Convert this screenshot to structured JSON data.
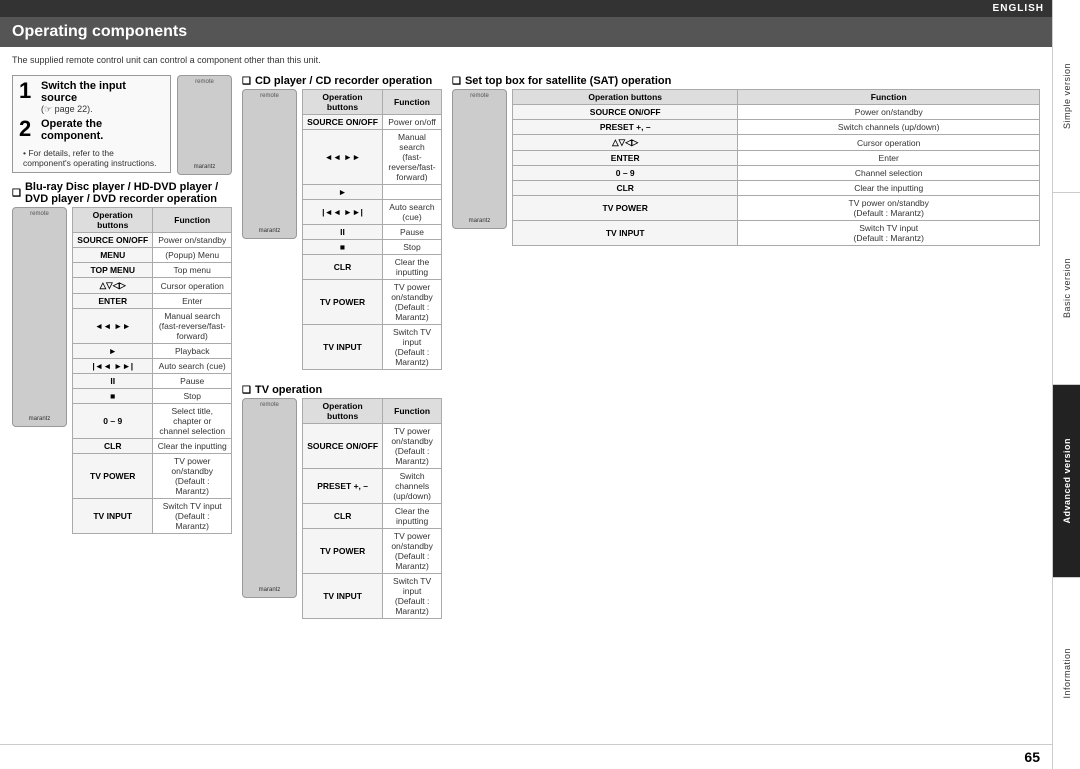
{
  "topbar": {
    "label": "ENGLISH"
  },
  "page_header": {
    "title": "Operating components"
  },
  "intro": {
    "text": "The supplied remote control unit can control a component other than this unit."
  },
  "steps": {
    "step1_num": "1",
    "step1_title": "Switch the input source",
    "step1_sub": "(☞ page 22).",
    "step2_num": "2",
    "step2_title": "Operate the component.",
    "step2_note": "• For details, refer to the component's operating instructions."
  },
  "sections": {
    "bluray": {
      "heading": "Blu-ray Disc player / HD-DVD player / DVD player / DVD recorder operation",
      "col_buttons": "Operation buttons",
      "col_function": "Function",
      "rows": [
        {
          "button": "SOURCE ON/OFF",
          "function": "Power on/standby"
        },
        {
          "button": "MENU",
          "function": "(Popup) Menu"
        },
        {
          "button": "TOP MENU",
          "function": "Top menu"
        },
        {
          "button": "△▽◁▷",
          "function": "Cursor operation"
        },
        {
          "button": "ENTER",
          "function": "Enter"
        },
        {
          "button": "◄◄ ►►",
          "function": "Manual search\n(fast-reverse/fast-forward)"
        },
        {
          "button": "►",
          "function": "Playback"
        },
        {
          "button": "|◄◄  ►►|",
          "function": "Auto search (cue)"
        },
        {
          "button": "II",
          "function": "Pause"
        },
        {
          "button": "■",
          "function": "Stop"
        },
        {
          "button": "0 – 9",
          "function": "Select title, chapter or channel selection"
        },
        {
          "button": "CLR",
          "function": "Clear the inputting"
        },
        {
          "button": "TV POWER",
          "function": "TV power on/standby\n(Default : Marantz)"
        },
        {
          "button": "TV INPUT",
          "function": "Switch TV input\n(Default : Marantz)"
        }
      ]
    },
    "cd": {
      "heading": "CD player / CD recorder operation",
      "col_buttons": "Operation buttons",
      "col_function": "Function",
      "rows": [
        {
          "button": "SOURCE ON/OFF",
          "function": "Power on/off"
        },
        {
          "button": "◄◄ ►►",
          "function": "Manual search\n(fast-reverse/fast-forward)"
        },
        {
          "button": "►",
          "function": ""
        },
        {
          "button": "|◄◄  ►►|",
          "function": "Auto search (cue)"
        },
        {
          "button": "II",
          "function": "Pause"
        },
        {
          "button": "■",
          "function": "Stop"
        },
        {
          "button": "CLR",
          "function": "Clear the inputting"
        },
        {
          "button": "TV POWER",
          "function": "TV power on/standby\n(Default : Marantz)"
        },
        {
          "button": "TV INPUT",
          "function": "Switch TV input\n(Default : Marantz)"
        }
      ]
    },
    "tv": {
      "heading": "TV operation",
      "col_buttons": "Operation buttons",
      "col_function": "Function",
      "rows": [
        {
          "button": "SOURCE ON/OFF",
          "function": "TV power on/standby\n(Default : Marantz)"
        },
        {
          "button": "PRESET +, –",
          "function": "Switch channels (up/down)"
        },
        {
          "button": "CLR",
          "function": "Clear the inputting"
        },
        {
          "button": "TV POWER",
          "function": "TV power on/standby\n(Default : Marantz)"
        },
        {
          "button": "TV INPUT",
          "function": "Switch TV input\n(Default : Marantz)"
        }
      ]
    },
    "sat": {
      "heading": "Set top box for satellite (SAT) operation",
      "col_buttons": "Operation buttons",
      "col_function": "Function",
      "rows": [
        {
          "button": "SOURCE ON/OFF",
          "function": "Power on/standby"
        },
        {
          "button": "PRESET +, –",
          "function": "Switch channels (up/down)"
        },
        {
          "button": "△▽◁▷",
          "function": "Cursor operation"
        },
        {
          "button": "ENTER",
          "function": "Enter"
        },
        {
          "button": "0 – 9",
          "function": "Channel selection"
        },
        {
          "button": "CLR",
          "function": "Clear the inputting"
        },
        {
          "button": "TV POWER",
          "function": "TV power on/standby\n(Default : Marantz)"
        },
        {
          "button": "TV INPUT",
          "function": "Switch TV input\n(Default : Marantz)"
        }
      ]
    }
  },
  "sidebar": {
    "sections": [
      "Simple version",
      "Basic version",
      "Advanced version",
      "Information"
    ]
  },
  "page_number": "65"
}
